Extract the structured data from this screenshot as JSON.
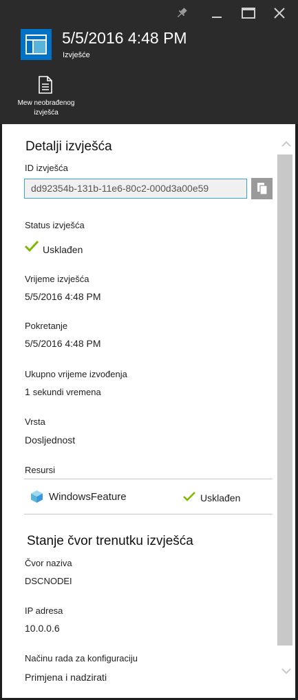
{
  "window": {
    "controls": [
      "pin-icon",
      "minimize-icon",
      "maximize-icon",
      "close-icon"
    ]
  },
  "blade": {
    "icon": "report-blade-icon",
    "title": "5/5/2016 4:48 PM",
    "subtitle": "Izvješće"
  },
  "command_bar": {
    "raw_report": {
      "icon": "document-icon",
      "label_line1": "Mew neobrađenog",
      "label_line2": "izvješća"
    }
  },
  "report_details": {
    "title": "Detalji izvješća",
    "report_id_label": "ID izvješća",
    "report_id_value": "dd92354b-131b-11e6-80c2-000d3a00e59",
    "status_label": "Status izvješća",
    "status_value": "Usklađen",
    "report_time_label": "Vrijeme izvješća",
    "report_time_value": "5/5/2016 4:48 PM",
    "start_label": "Pokretanje",
    "start_value": "5/5/2016 4:48 PM",
    "duration_label": "Ukupno vrijeme izvođenja",
    "duration_number": "1",
    "duration_unit": "sekundi vremena",
    "type_label": "Vrsta",
    "type_value": "Dosljednost",
    "resources_label": "Resursi",
    "resources": [
      {
        "name": "WindowsFeature",
        "status": "Usklađen"
      }
    ]
  },
  "node_state": {
    "title": "Stanje čvor trenutku izvješća",
    "node_name_label": "Čvor naziva",
    "node_name_value": "DSCNODEI",
    "ip_label": "IP adresa",
    "ip_value": "10.0.0.6",
    "config_mode_label": "Načinu rada za konfiguraciju",
    "config_mode_value": "Primjena i nadzirati"
  },
  "colors": {
    "header_bg": "#2b2b2b",
    "accent_blue": "#3aa0d8",
    "check_green": "#7fba00",
    "scrollbar_thumb": "#c8c8c8",
    "copy_button_bg": "#9a9a9a"
  }
}
